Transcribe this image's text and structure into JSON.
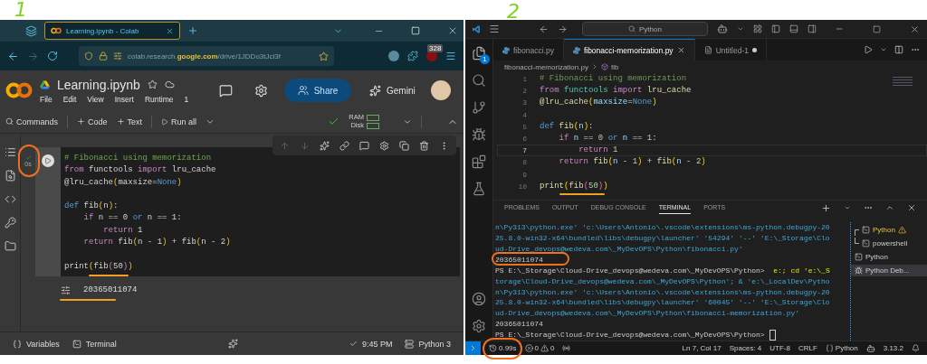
{
  "annotations": {
    "left_label": "1",
    "right_label": "2"
  },
  "browser": {
    "tab": {
      "title": "Learning.ipynb - Colab",
      "selected": true
    },
    "url": "colab.research.**google.com**/drive/1JDDo3tJcl3f",
    "badge": "328"
  },
  "colab": {
    "title": "Learning.ipynb",
    "menu": [
      "File",
      "Edit",
      "View",
      "Insert",
      "Runtime",
      "1"
    ],
    "share": "Share",
    "gemini": "Gemini",
    "toolbar": {
      "commands": "Commands",
      "add_code": "Code",
      "add_text": "Text",
      "run_all": "Run all",
      "ram": "RAM",
      "disk": "Disk"
    },
    "cell": {
      "status": "0s",
      "output": "20365011074",
      "lines": [
        {
          "kind": "code",
          "tokens": [
            {
              "text": "# Fibonacci using memorization",
              "kind": "comment"
            }
          ]
        },
        {
          "kind": "code",
          "tokens": [
            {
              "text": "from",
              "kind": "control"
            },
            {
              "text": " functools ",
              "kind": "plain"
            },
            {
              "text": "import",
              "kind": "control"
            },
            {
              "text": " lru_cache",
              "kind": "plain"
            }
          ]
        },
        {
          "kind": "code",
          "tokens": [
            {
              "text": "@lru_cache",
              "kind": "plain"
            },
            {
              "text": "(",
              "kind": "paren"
            },
            {
              "text": "maxsize=",
              "kind": "plain"
            },
            {
              "text": "None",
              "kind": "keyword"
            },
            {
              "text": ")",
              "kind": "paren"
            }
          ]
        },
        {
          "kind": "blank"
        },
        {
          "kind": "code",
          "tokens": [
            {
              "text": "def",
              "kind": "keyword"
            },
            {
              "text": " fib",
              "kind": "plain"
            },
            {
              "text": "(",
              "kind": "paren"
            },
            {
              "text": "n",
              "kind": "plain"
            },
            {
              "text": ")",
              "kind": "paren"
            },
            {
              "text": ":",
              "kind": "plain"
            }
          ]
        },
        {
          "kind": "code",
          "tokens": [
            {
              "text": "    if",
              "kind": "control"
            },
            {
              "text": " n == 0 ",
              "kind": "plain"
            },
            {
              "text": "or",
              "kind": "keyword"
            },
            {
              "text": " n == 1:",
              "kind": "plain"
            }
          ]
        },
        {
          "kind": "code",
          "tokens": [
            {
              "text": "        return",
              "kind": "control"
            },
            {
              "text": " 1",
              "kind": "plain"
            }
          ]
        },
        {
          "kind": "code",
          "tokens": [
            {
              "text": "    return",
              "kind": "control"
            },
            {
              "text": " fib",
              "kind": "plain"
            },
            {
              "text": "(",
              "kind": "paren"
            },
            {
              "text": "n - 1",
              "kind": "plain"
            },
            {
              "text": ")",
              "kind": "paren"
            },
            {
              "text": " + fib",
              "kind": "plain"
            },
            {
              "text": "(",
              "kind": "paren"
            },
            {
              "text": "n - 2",
              "kind": "plain"
            },
            {
              "text": ")",
              "kind": "paren"
            }
          ]
        },
        {
          "kind": "blank"
        },
        {
          "kind": "code",
          "tokens": [
            {
              "text": "print",
              "kind": "plain"
            },
            {
              "text": "(",
              "kind": "paren"
            },
            {
              "text": "fib",
              "kind": "plain"
            },
            {
              "text": "(",
              "kind": "paren2"
            },
            {
              "text": "50",
              "kind": "plain"
            },
            {
              "text": ")",
              "kind": "paren2"
            },
            {
              "text": ")",
              "kind": "paren"
            }
          ]
        }
      ]
    },
    "status_bar": {
      "variables": "Variables",
      "terminal": "Terminal",
      "time": "9:45 PM",
      "runtime": "Python 3"
    }
  },
  "vscode": {
    "search": "Python",
    "explorer_badge": "1",
    "tabs": [
      {
        "label": "fibonacci.py",
        "selected": false,
        "modified": false
      },
      {
        "label": "fibonacci-memorization.py",
        "selected": true,
        "modified": false
      },
      {
        "label": "Untitled-1",
        "selected": false,
        "modified": true
      }
    ],
    "breadcrumb": {
      "file": "fibonacci-memorization.py",
      "symbol": "fib"
    },
    "lines": [
      {
        "number": "1",
        "selected": false,
        "kind": "code",
        "tokens": [
          {
            "text": "# Fibonacci using memorization",
            "kind": "comment"
          }
        ]
      },
      {
        "number": "2",
        "selected": false,
        "kind": "code",
        "tokens": [
          {
            "text": "from",
            "kind": "control"
          },
          {
            "text": " functools ",
            "kind": "module"
          },
          {
            "text": "import",
            "kind": "control"
          },
          {
            "text": " lru_cache",
            "kind": "function"
          }
        ]
      },
      {
        "number": "3",
        "selected": false,
        "kind": "code",
        "tokens": [
          {
            "text": "@lru_cache",
            "kind": "function"
          },
          {
            "text": "(",
            "kind": "paren"
          },
          {
            "text": "maxsize",
            "kind": "variable"
          },
          {
            "text": "=",
            "kind": "plain"
          },
          {
            "text": "None",
            "kind": "keyword"
          },
          {
            "text": ")",
            "kind": "paren"
          }
        ]
      },
      {
        "number": "4",
        "selected": false,
        "kind": "blank"
      },
      {
        "number": "5",
        "selected": false,
        "kind": "code",
        "tokens": [
          {
            "text": "def",
            "kind": "keyword"
          },
          {
            "text": " fib",
            "kind": "function"
          },
          {
            "text": "(",
            "kind": "paren"
          },
          {
            "text": "n",
            "kind": "variable"
          },
          {
            "text": ")",
            "kind": "paren"
          },
          {
            "text": ":",
            "kind": "plain"
          }
        ]
      },
      {
        "number": "6",
        "selected": false,
        "kind": "code",
        "tokens": [
          {
            "text": "    if",
            "kind": "control"
          },
          {
            "text": " n",
            "kind": "variable"
          },
          {
            "text": " == ",
            "kind": "plain"
          },
          {
            "text": "0",
            "kind": "number"
          },
          {
            "text": " or",
            "kind": "keyword"
          },
          {
            "text": " n",
            "kind": "variable"
          },
          {
            "text": " == ",
            "kind": "plain"
          },
          {
            "text": "1",
            "kind": "number"
          },
          {
            "text": ":",
            "kind": "plain"
          }
        ]
      },
      {
        "number": "7",
        "selected": true,
        "kind": "code",
        "tokens": [
          {
            "text": "        return",
            "kind": "control"
          },
          {
            "text": " 1",
            "kind": "number"
          }
        ]
      },
      {
        "number": "8",
        "selected": false,
        "kind": "code",
        "tokens": [
          {
            "text": "    return",
            "kind": "control"
          },
          {
            "text": " fib",
            "kind": "function"
          },
          {
            "text": "(",
            "kind": "paren"
          },
          {
            "text": "n",
            "kind": "variable"
          },
          {
            "text": " - ",
            "kind": "plain"
          },
          {
            "text": "1",
            "kind": "number"
          },
          {
            "text": ")",
            "kind": "paren"
          },
          {
            "text": " + ",
            "kind": "plain"
          },
          {
            "text": "fib",
            "kind": "function"
          },
          {
            "text": "(",
            "kind": "paren"
          },
          {
            "text": "n",
            "kind": "variable"
          },
          {
            "text": " - ",
            "kind": "plain"
          },
          {
            "text": "2",
            "kind": "number"
          },
          {
            "text": ")",
            "kind": "paren"
          }
        ]
      },
      {
        "number": "9",
        "selected": false,
        "kind": "blank"
      },
      {
        "number": "10",
        "selected": false,
        "kind": "code",
        "tokens": [
          {
            "text": "print",
            "kind": "function"
          },
          {
            "text": "(",
            "kind": "paren"
          },
          {
            "text": "fib",
            "kind": "function"
          },
          {
            "text": "(",
            "kind": "paren2"
          },
          {
            "text": "50",
            "kind": "number"
          },
          {
            "text": ")",
            "kind": "paren2"
          },
          {
            "text": ")",
            "kind": "paren"
          }
        ]
      }
    ],
    "panel_tabs": [
      {
        "label": "PROBLEMS",
        "selected": false
      },
      {
        "label": "OUTPUT",
        "selected": false
      },
      {
        "label": "DEBUG CONSOLE",
        "selected": false
      },
      {
        "label": "TERMINAL",
        "selected": true
      },
      {
        "label": "PORTS",
        "selected": false
      }
    ],
    "terminal": [
      {
        "kind": "command",
        "text": "n\\Py313\\python.exe' 'c:\\Users\\Antonio\\.vscode\\extensions\\ms-python.debugpy-20"
      },
      {
        "kind": "command",
        "text": "25.8.0-win32-x64\\bundled\\libs\\debugpy\\launcher' '54294' '--' 'E:\\_Storage\\Clo"
      },
      {
        "kind": "command",
        "text": "ud-Drive_devops@wedeva.com\\_MyDevOPS\\Python\\fibonacci.py'"
      },
      {
        "kind": "output",
        "text": "20365011074"
      },
      {
        "kind": "prompt",
        "prompt": "PS E:\\_Storage\\Cloud-Drive_devops@wedeva.com\\_MyDevOPS\\Python>",
        "text": "e:; cd 'e:\\_S"
      },
      {
        "kind": "command",
        "text": "torage\\Cloud-Drive_devops@wedeva.com\\_MyDevOPS\\Python'; & 'e:\\_LocalDev\\Pytho"
      },
      {
        "kind": "command",
        "text": "n\\Py313\\python.exe' 'c:\\Users\\Antonio\\.vscode\\extensions\\ms-python.debugpy-20"
      },
      {
        "kind": "command",
        "text": "25.8.0-win32-x64\\bundled\\libs\\debugpy\\launcher' '60045' '--' 'E:\\_Storage\\Clo"
      },
      {
        "kind": "command",
        "text": "ud-Drive_devops@wedeva.com\\_MyDevOPS\\Python\\fibonacci-memorization.py'"
      },
      {
        "kind": "output",
        "text": "20365011074"
      },
      {
        "kind": "idle",
        "prompt": "PS E:\\_Storage\\Cloud-Drive_devops@wedeva.com\\_MyDevOPS\\Python>"
      }
    ],
    "terminals": [
      {
        "label": "Python",
        "kind": "split_top",
        "selected": false
      },
      {
        "label": "powershell",
        "kind": "split_bottom",
        "selected": false
      },
      {
        "label": "Python",
        "kind": "single",
        "selected": false
      },
      {
        "label": "Python Deb...",
        "kind": "debug",
        "selected": true
      }
    ],
    "status_bar": {
      "duration": "0.99s",
      "errors": "0",
      "warnings": "0",
      "position": "Ln 7, Col 17",
      "spaces": "Spaces: 4",
      "encoding": "UTF-8",
      "eol": "CRLF",
      "language": "Python",
      "version": "3.13.2"
    }
  }
}
